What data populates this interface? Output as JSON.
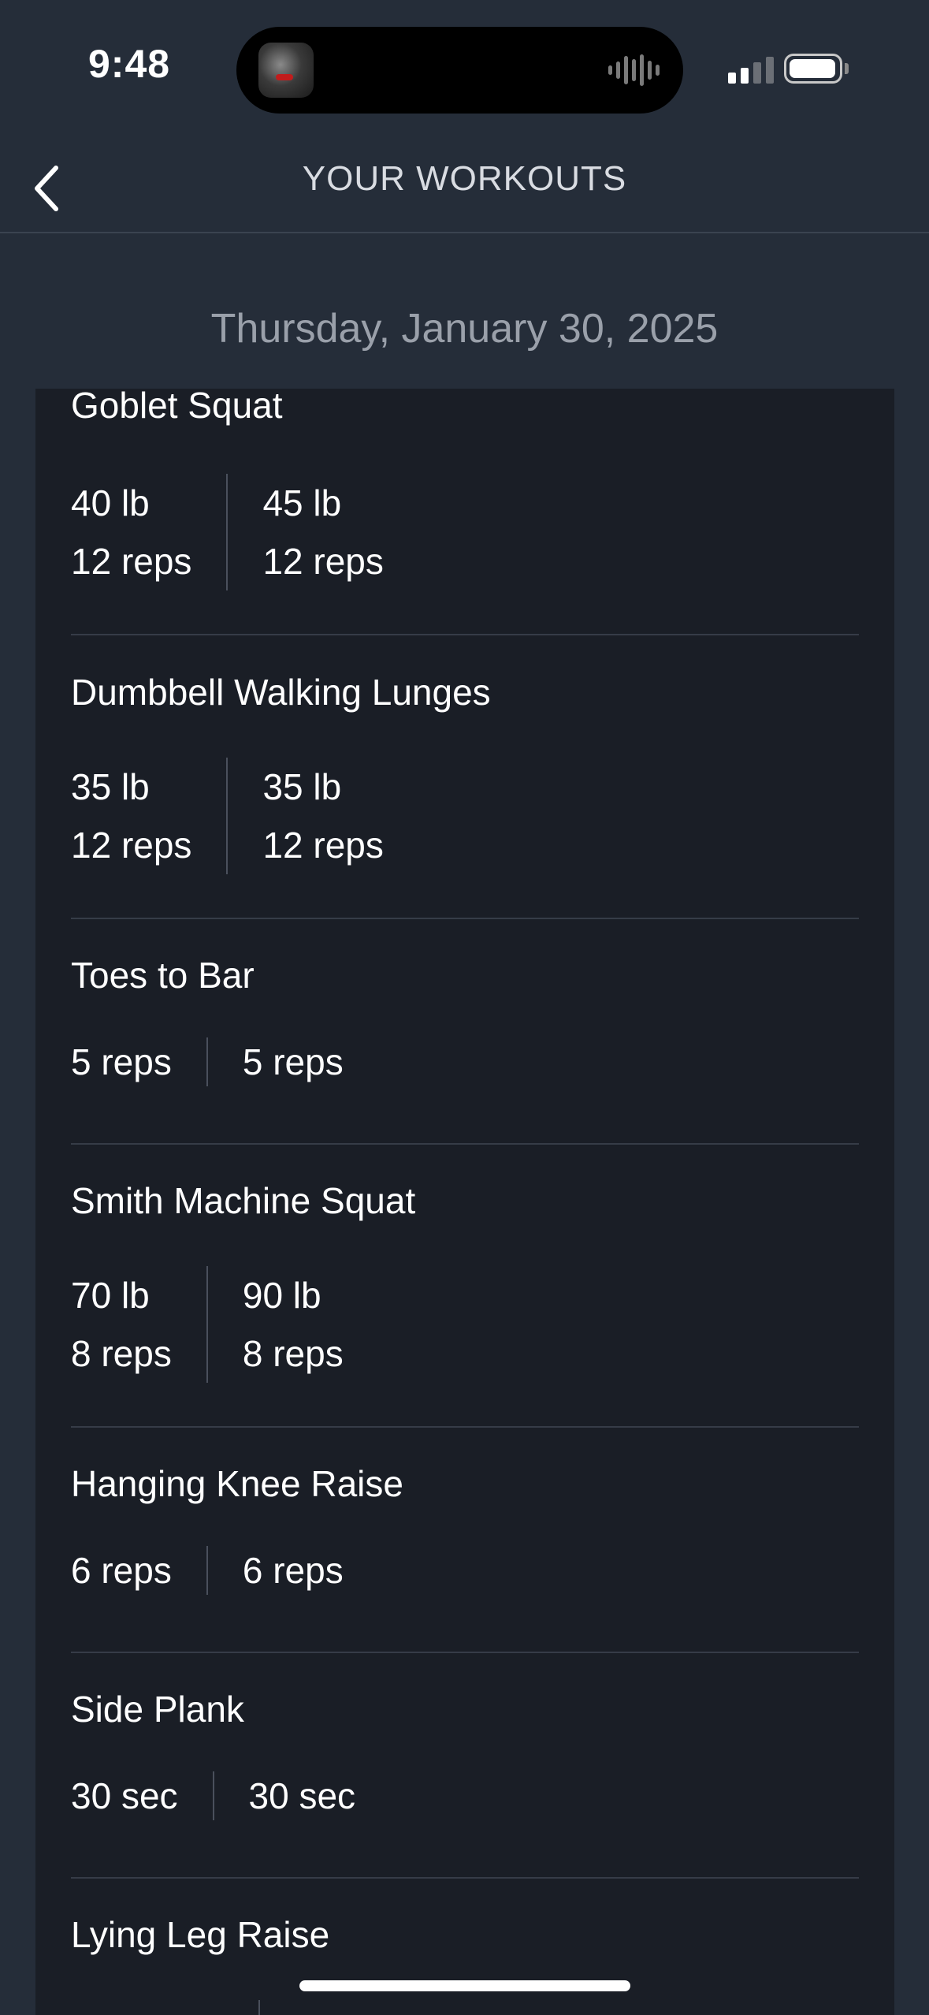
{
  "status_bar": {
    "time": "9:48",
    "signal_bars": 4,
    "signal_active_bars": 2,
    "battery_level_percent": 90
  },
  "header": {
    "title": "YOUR WORKOUTS",
    "back_icon": "chevron-left-icon"
  },
  "date": "Thursday, January 30, 2025",
  "exercises": [
    {
      "name": "Goblet Squat",
      "sets": [
        {
          "weight": "40 lb",
          "reps": "12 reps"
        },
        {
          "weight": "45 lb",
          "reps": "12 reps"
        }
      ]
    },
    {
      "name": "Dumbbell Walking Lunges",
      "sets": [
        {
          "weight": "35 lb",
          "reps": "12 reps"
        },
        {
          "weight": "35 lb",
          "reps": "12 reps"
        }
      ]
    },
    {
      "name": "Toes to Bar",
      "sets": [
        {
          "reps": "5 reps"
        },
        {
          "reps": "5 reps"
        }
      ]
    },
    {
      "name": "Smith Machine Squat",
      "sets": [
        {
          "weight": "70 lb",
          "reps": "8 reps"
        },
        {
          "weight": "90 lb",
          "reps": "8 reps"
        }
      ]
    },
    {
      "name": "Hanging Knee Raise",
      "sets": [
        {
          "reps": "6 reps"
        },
        {
          "reps": "6 reps"
        }
      ]
    },
    {
      "name": "Side Plank",
      "sets": [
        {
          "duration": "30 sec"
        },
        {
          "duration": "30 sec"
        }
      ]
    },
    {
      "name": "Lying Leg Raise",
      "sets": []
    }
  ],
  "colors": {
    "background": "#252d39",
    "card": "#1a1e26",
    "header_text": "#d9dce2",
    "date_text": "#9aa0aa",
    "divider": "#363c47"
  }
}
